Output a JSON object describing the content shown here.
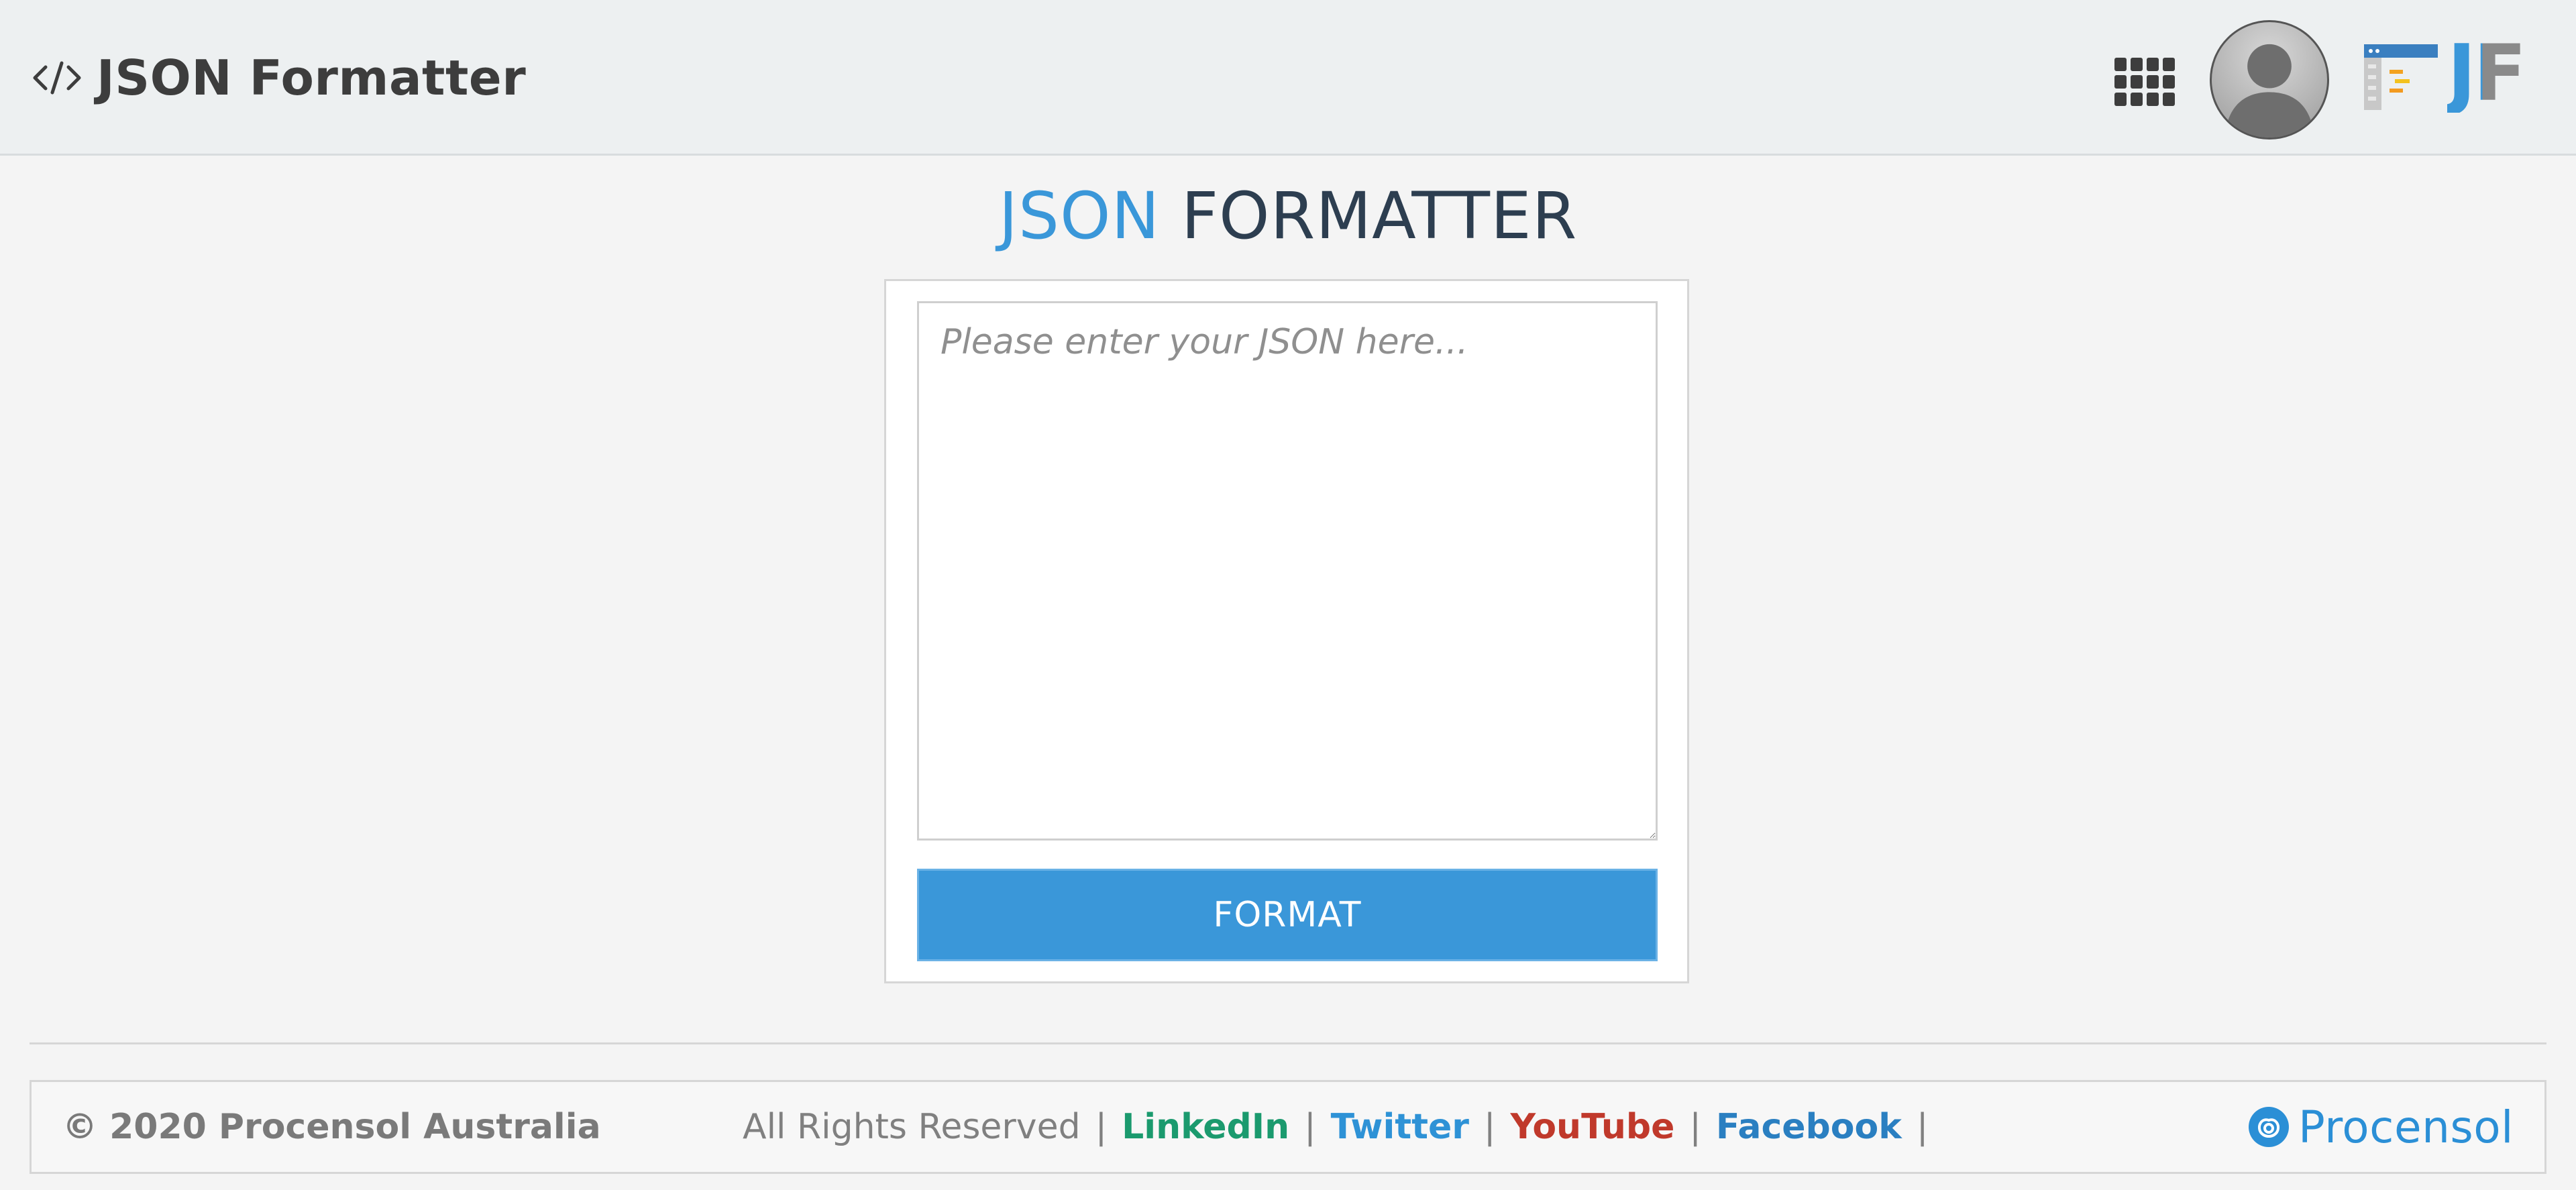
{
  "header": {
    "brand_title": "JSON Formatter",
    "brand_icon": "code-icon",
    "apps_icon": "grid-icon",
    "avatar_icon": "user-avatar-icon",
    "logo_text": "JF",
    "colors": {
      "background": "#edf0f1",
      "text": "#3d3d3d"
    }
  },
  "main": {
    "title_accent": "JSON",
    "title_rest": "FORMATTER",
    "input_placeholder": "Please enter your JSON here...",
    "input_value": "",
    "format_button": "FORMAT",
    "colors": {
      "accent": "#3a97d9",
      "title_dark": "#2d3e50"
    }
  },
  "footer": {
    "copyright": "© 2020 Procensol Australia",
    "rights": "All Rights Reserved",
    "separator": "|",
    "links": {
      "linkedin": "LinkedIn",
      "twitter": "Twitter",
      "youtube": "YouTube",
      "facebook": "Facebook"
    },
    "brand": "Procensol",
    "colors": {
      "linkedin": "#1b9a6e",
      "twitter": "#2e92d6",
      "youtube": "#c0392b",
      "facebook": "#2a7fc1"
    }
  }
}
